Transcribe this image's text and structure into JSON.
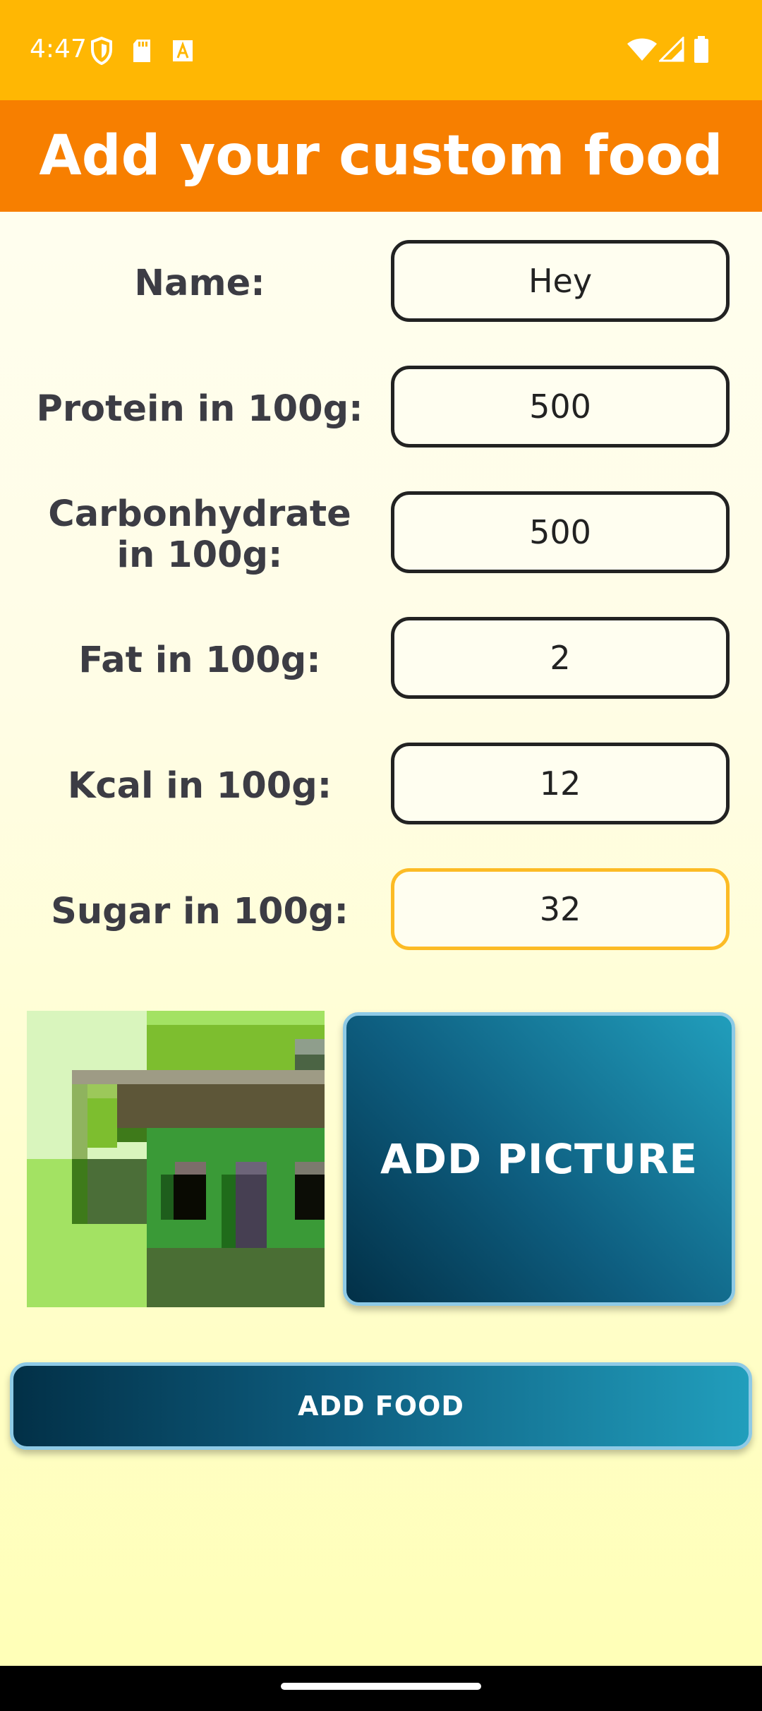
{
  "status_bar": {
    "time": "4:47",
    "icons_left": [
      "shield-icon",
      "sd-card-icon",
      "font-icon"
    ],
    "icons_right": [
      "wifi-icon",
      "cellular-signal-icon",
      "battery-icon"
    ]
  },
  "header": {
    "title": "Add your custom food"
  },
  "form": {
    "fields": [
      {
        "label": "Name:",
        "value": "Hey"
      },
      {
        "label": "Protein in 100g:",
        "value": "500"
      },
      {
        "label": "Carbonhydrate in 100g:",
        "value": "500"
      },
      {
        "label": "Fat in 100g:",
        "value": "2"
      },
      {
        "label": "Kcal in 100g:",
        "value": "12"
      },
      {
        "label": "Sugar in 100g:",
        "value": "32"
      }
    ]
  },
  "image_preview": {
    "icon": "pixel-house-image"
  },
  "buttons": {
    "add_picture": "ADD PICTURE",
    "add_food": "ADD FOOD"
  },
  "colors": {
    "status_bar": "#ffb703",
    "header": "#f77f00",
    "focused_border": "#fcbb25",
    "button_dark": "#023047",
    "button_light": "#219ebc",
    "button_border": "#8ecae6"
  }
}
